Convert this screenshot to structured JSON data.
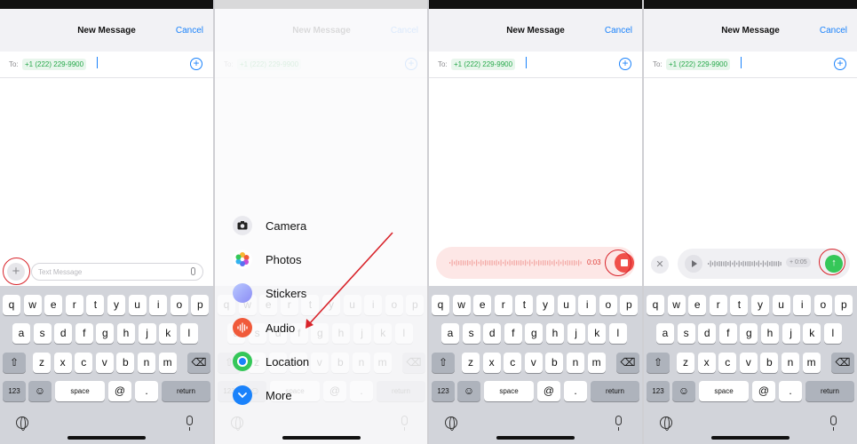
{
  "header": {
    "title": "New Message",
    "cancel_label": "Cancel"
  },
  "to_row": {
    "label": "To:",
    "recipient": "+1 (222) 229-9900"
  },
  "compose": {
    "placeholder": "Text Message"
  },
  "keyboard": {
    "row1": [
      "q",
      "w",
      "e",
      "r",
      "t",
      "y",
      "u",
      "i",
      "o",
      "p"
    ],
    "row2": [
      "a",
      "s",
      "d",
      "f",
      "g",
      "h",
      "j",
      "k",
      "l"
    ],
    "row3": [
      "z",
      "x",
      "c",
      "v",
      "b",
      "n",
      "m"
    ],
    "shift": "⇧",
    "backspace": "⌫",
    "numbers": "123",
    "emoji": "☺",
    "space": "space",
    "at": "@",
    "period": ".",
    "return": "return"
  },
  "attach_menu": {
    "items": [
      {
        "label": "Camera",
        "icon": "camera-icon",
        "color": "#e9e9ee"
      },
      {
        "label": "Photos",
        "icon": "photos-icon",
        "color": "#f7b733"
      },
      {
        "label": "Stickers",
        "icon": "stickers-icon",
        "color": "#8b8cf5"
      },
      {
        "label": "Audio",
        "icon": "audio-waveform-icon",
        "color": "#f05a3a"
      },
      {
        "label": "Location",
        "icon": "location-icon",
        "color": "#35c759"
      },
      {
        "label": "More",
        "icon": "chevron-down-icon",
        "color": "#1a82fb"
      }
    ]
  },
  "recording": {
    "time": "0:03"
  },
  "preview": {
    "duration": "+ 0:05"
  },
  "colors": {
    "accent": "#1a82fb",
    "recipient_green": "#26a84a",
    "record_red": "#f0504a",
    "send_green": "#35c759",
    "annotation_red": "#d8232a"
  }
}
